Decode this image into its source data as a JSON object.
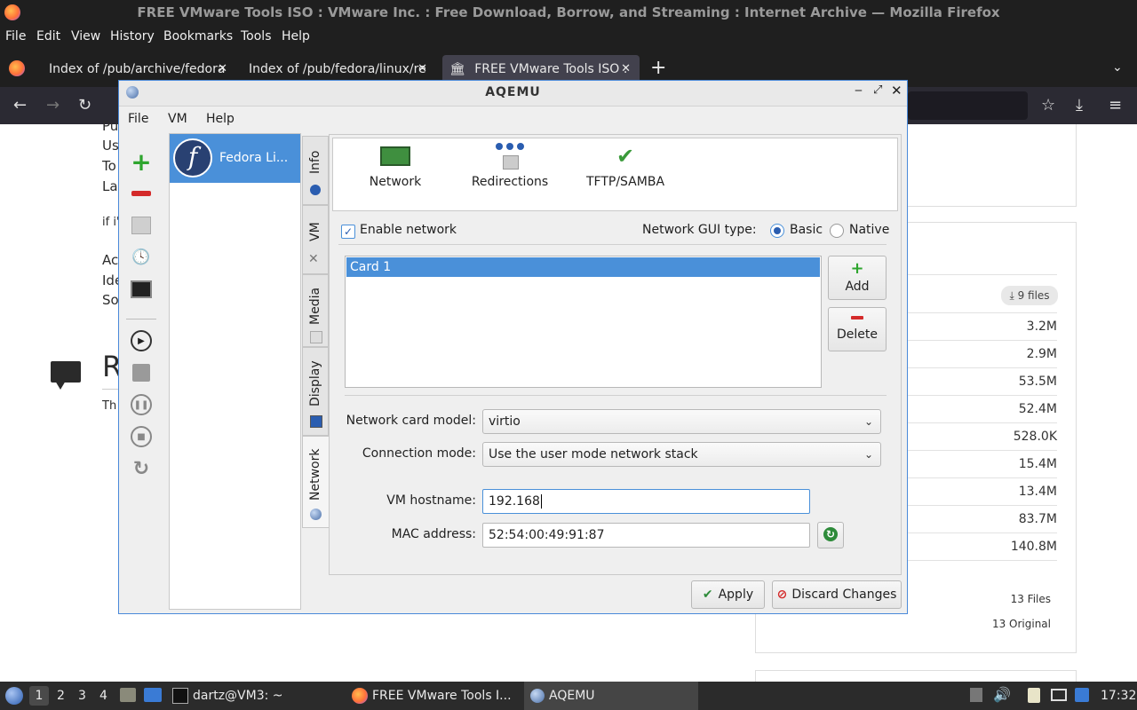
{
  "firefox": {
    "window_title": "FREE VMware Tools ISO : VMware Inc. : Free Download, Borrow, and Streaming : Internet Archive — Mozilla Firefox",
    "menu": [
      "File",
      "Edit",
      "View",
      "History",
      "Bookmarks",
      "Tools",
      "Help"
    ],
    "tabs": [
      {
        "label": "Index of /pub/archive/fedora"
      },
      {
        "label": "Index of /pub/fedora/linux/re"
      },
      {
        "label": "FREE VMware Tools ISO :"
      }
    ]
  },
  "page_behind": {
    "left_text": [
      "Pu",
      "Us",
      "To",
      "La",
      "if i'",
      "Ac",
      "Ide",
      "So",
      "R",
      "Th"
    ],
    "files_button": "9 files",
    "sizes": [
      "3.2M",
      "2.9M",
      "53.5M",
      "52.4M",
      "528.0K",
      "15.4M",
      "13.4M",
      "83.7M",
      "140.8M"
    ],
    "summary": [
      "13 Files",
      "13 Original"
    ]
  },
  "aqemu": {
    "title": "AQEMU",
    "menu": [
      "File",
      "VM",
      "Help"
    ],
    "vm_name": "Fedora Li...",
    "side_tabs": [
      "Info",
      "VM",
      "Media",
      "Display",
      "Network"
    ],
    "network_tabs": [
      "Network",
      "Redirections",
      "TFTP/SAMBA"
    ],
    "enable_network_label": "Enable network",
    "enable_network_checked": true,
    "gui_type_label": "Network GUI type:",
    "gui_type_options": [
      "Basic",
      "Native"
    ],
    "gui_type_selected": "Basic",
    "cards": [
      "Card 1"
    ],
    "add_button": "Add",
    "delete_button": "Delete",
    "card_model_label": "Network card model:",
    "card_model_value": "virtio",
    "connection_mode_label": "Connection mode:",
    "connection_mode_value": "Use the user mode network stack",
    "hostname_label": "VM hostname:",
    "hostname_value": "192.168",
    "mac_label": "MAC address:",
    "mac_value": "52:54:00:49:91:87",
    "apply_button": "Apply",
    "discard_button": "Discard Changes"
  },
  "taskbar": {
    "workspaces": [
      "1",
      "2",
      "3",
      "4"
    ],
    "active_workspace": "1",
    "tasks": [
      "dartz@VM3: ~",
      "FREE VMware Tools I...",
      "AQEMU"
    ],
    "clock": "17:32"
  },
  "colors": {
    "accent": "#4a90d9",
    "titlebar_dark": "#1f1f1f",
    "taskbar": "#2b2b2b"
  }
}
